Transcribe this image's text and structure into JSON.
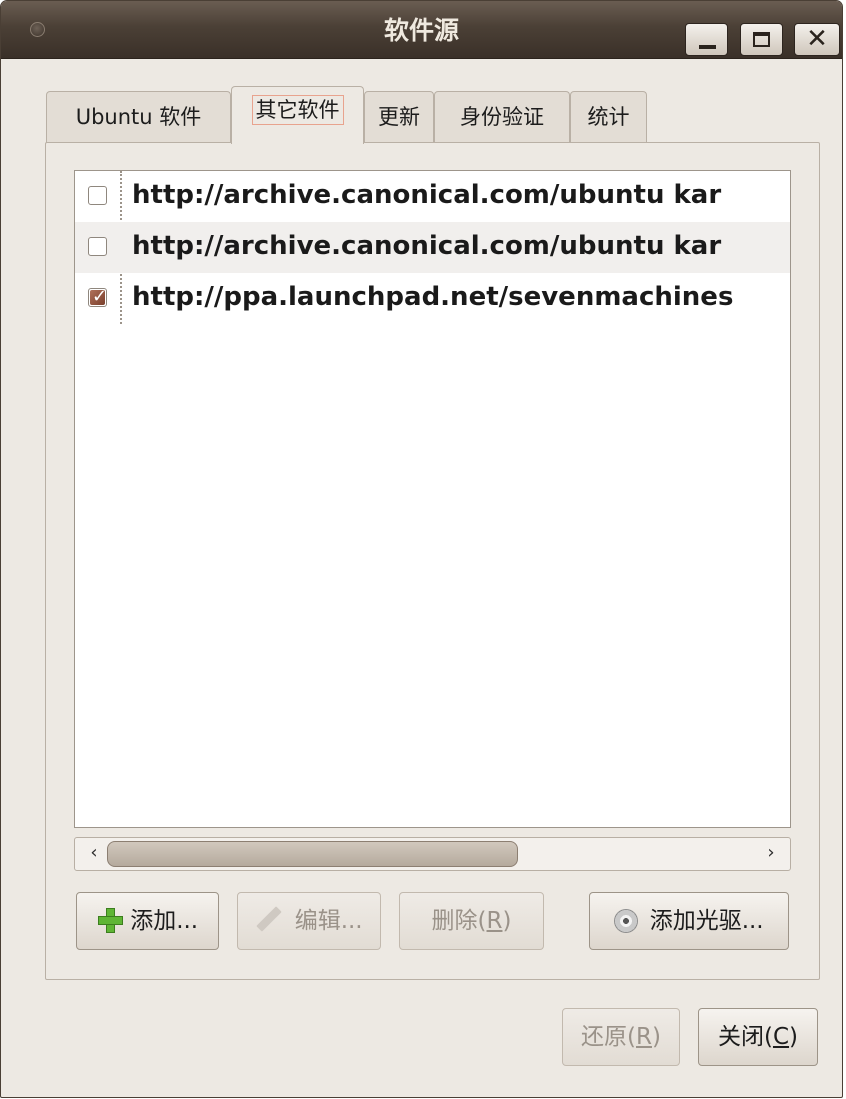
{
  "window": {
    "title": "软件源",
    "controls": {
      "minimize": "▁",
      "maximize": "□",
      "close": "✕"
    }
  },
  "tabs": [
    {
      "label": "Ubuntu 软件",
      "active": false
    },
    {
      "label": "其它软件",
      "active": true
    },
    {
      "label": "更新",
      "active": false
    },
    {
      "label": "身份验证",
      "active": false
    },
    {
      "label": "统计",
      "active": false
    }
  ],
  "sources": [
    {
      "checked": false,
      "url": "http://archive.canonical.com/ubuntu kar"
    },
    {
      "checked": false,
      "url": "http://archive.canonical.com/ubuntu kar"
    },
    {
      "checked": true,
      "url": "http://ppa.launchpad.net/sevenmachines"
    }
  ],
  "scrollbar": {
    "left_arrow": "‹",
    "right_arrow": "›"
  },
  "buttons": {
    "add": "添加...",
    "edit": "编辑...",
    "remove_prefix": "删除(",
    "remove_mnemonic": "R",
    "remove_suffix": ")",
    "add_cdrom": "添加光驱..."
  },
  "footer": {
    "revert_prefix": "还原(",
    "revert_mnemonic": "R",
    "revert_suffix": ")",
    "close_prefix": "关闭(",
    "close_mnemonic": "C",
    "close_suffix": ")"
  },
  "icons": [
    "window-menu-icon",
    "minimize-icon",
    "maximize-icon",
    "close-icon",
    "plus-icon",
    "pencil-icon",
    "disc-icon"
  ]
}
